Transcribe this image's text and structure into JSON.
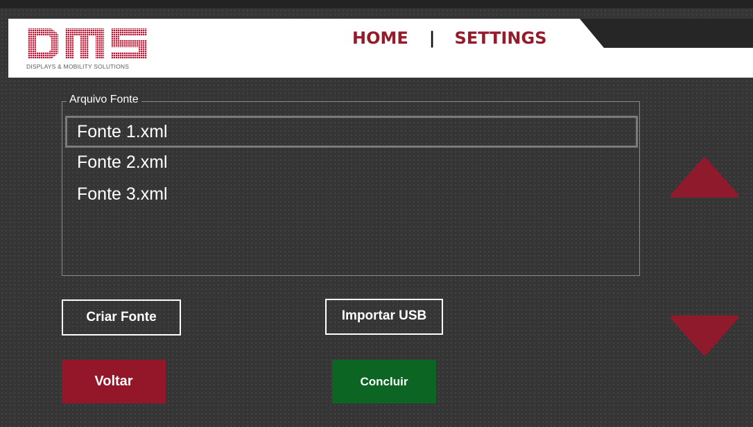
{
  "header": {
    "logo_text": "DMS",
    "logo_tagline": "DISPLAYS & MOBILITY SOLUTIONS",
    "nav_home": "HOME",
    "nav_separator": "|",
    "nav_settings": "SETTINGS"
  },
  "file_list": {
    "legend": "Arquivo Fonte",
    "items": [
      {
        "label": "Fonte 1.xml",
        "selected": true
      },
      {
        "label": "Fonte 2.xml",
        "selected": false
      },
      {
        "label": "Fonte 3.xml",
        "selected": false
      }
    ]
  },
  "buttons": {
    "create_font": "Criar Fonte",
    "import_usb": "Importar USB",
    "back": "Voltar",
    "finish": "Concluir"
  },
  "icons": {
    "scroll_up": "triangle-up-icon",
    "scroll_down": "triangle-down-icon"
  },
  "colors": {
    "brand_red": "#931629",
    "nav_red": "#951b2b",
    "finish_green": "#0c6522",
    "arrow_red": "#8f1a2c",
    "background": "#353535"
  }
}
